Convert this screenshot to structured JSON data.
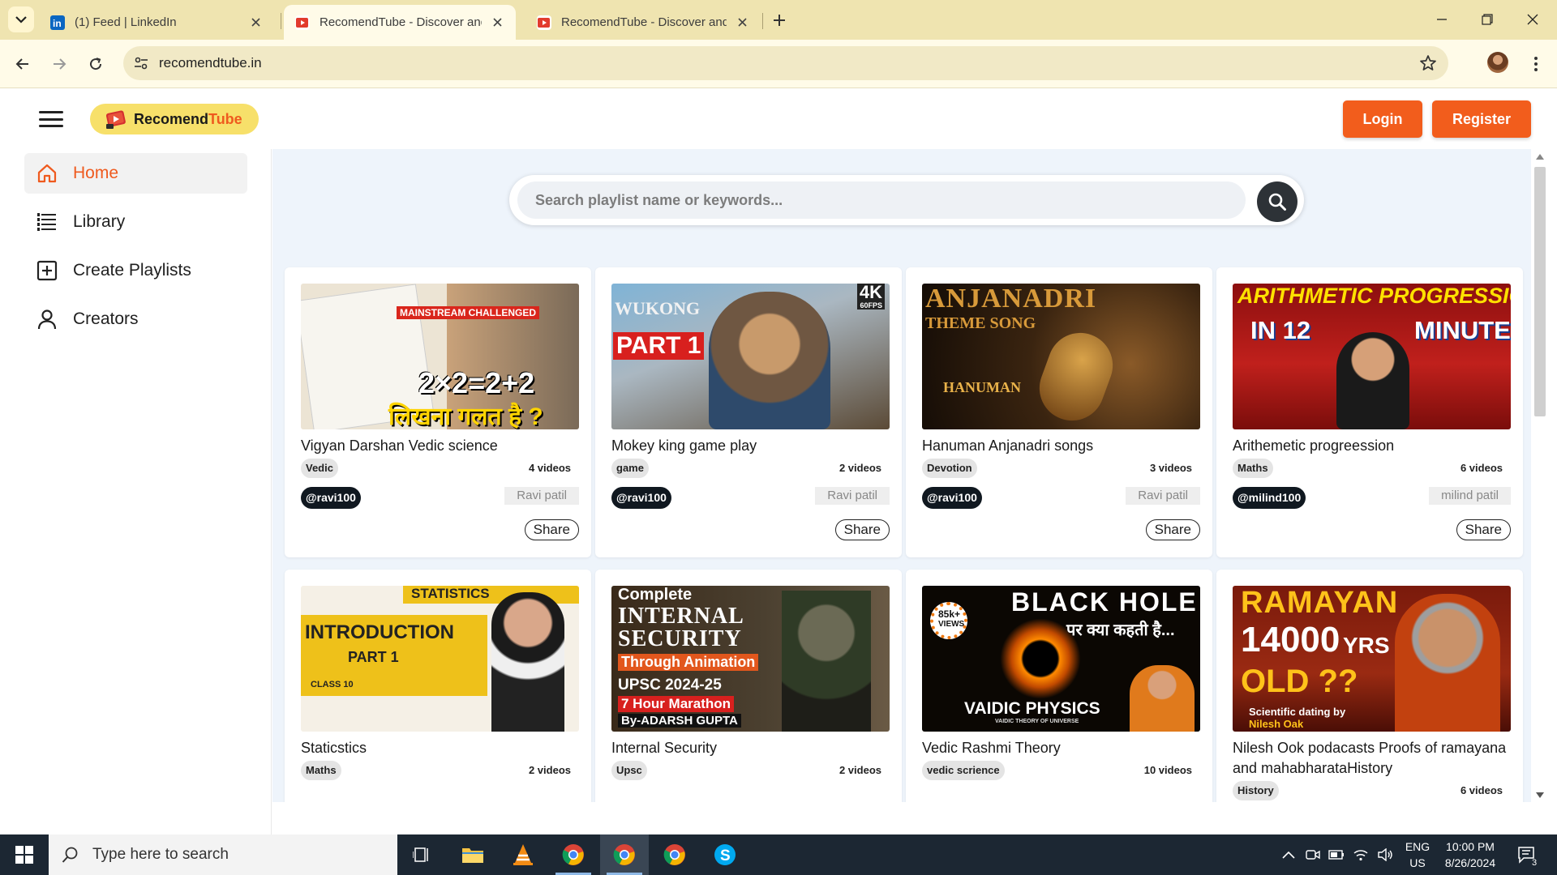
{
  "browser": {
    "tabs": [
      {
        "title": "(1) Feed | LinkedIn",
        "active": false
      },
      {
        "title": "RecomendTube - Discover and",
        "active": true
      },
      {
        "title": "RecomendTube - Discover and",
        "active": false
      }
    ],
    "url": "recomendtube.in"
  },
  "header": {
    "logo_part1": "Recomend",
    "logo_part2": "Tube",
    "login_label": "Login",
    "register_label": "Register"
  },
  "sidebar": {
    "items": [
      {
        "label": "Home",
        "icon": "home-icon",
        "active": true
      },
      {
        "label": "Library",
        "icon": "library-icon",
        "active": false
      },
      {
        "label": "Create Playlists",
        "icon": "add-box-icon",
        "active": false
      },
      {
        "label": "Creators",
        "icon": "person-icon",
        "active": false
      }
    ]
  },
  "search": {
    "placeholder": "Search playlist name or keywords..."
  },
  "playlists": [
    {
      "title": "Vigyan Darshan Vedic science",
      "category": "Vedic",
      "videos": "4 videos",
      "handle": "@ravi100",
      "owner": "Ravi patil",
      "share": "Share",
      "thumb": {
        "t1": "MAINSTREAM CHALLENGED",
        "t2": "2×2=2+2",
        "t3": "लिखना गलत है ?"
      }
    },
    {
      "title": "Mokey king game play",
      "category": "game",
      "videos": "2 videos",
      "handle": "@ravi100",
      "owner": "Ravi patil",
      "share": "Share",
      "thumb": {
        "t1": "WUKONG",
        "t2": "PART 1",
        "t3": "4K",
        "t4": "60FPS"
      }
    },
    {
      "title": "Hanuman Anjanadri songs",
      "category": "Devotion",
      "videos": "3 videos",
      "handle": "@ravi100",
      "owner": "Ravi patil",
      "share": "Share",
      "thumb": {
        "t1": "ANJANADRI",
        "t2": "THEME SONG",
        "t3": "HANUMAN"
      }
    },
    {
      "title": "Arithemetic progreession",
      "category": "Maths",
      "videos": "6 videos",
      "handle": "@milind100",
      "owner": "milind patil",
      "share": "Share",
      "thumb": {
        "t1": "ARITHMETIC PROGRESSIONS",
        "t2": "IN 12",
        "t3": "MINUTES"
      }
    },
    {
      "title": "Staticstics",
      "category": "Maths",
      "videos": "2 videos",
      "thumb": {
        "t1": "STATISTICS",
        "t2": "INTRODUCTION",
        "t3": "PART 1",
        "t4": "CLASS 10"
      }
    },
    {
      "title": "Internal Security",
      "category": "Upsc",
      "videos": "2 videos",
      "thumb": {
        "t1": "Complete",
        "t2": "INTERNAL",
        "t3": "SECURITY",
        "t4": "Through Animation",
        "t5": "UPSC 2024-25",
        "t6": "7 Hour Marathon",
        "t7": "By-ADARSH GUPTA"
      }
    },
    {
      "title": "Vedic Rashmi Theory",
      "category": "vedic scrience",
      "videos": "10 videos",
      "thumb": {
        "t1": "BLACK HOLE",
        "t2": "पर क्या कहती है...",
        "t3": "85k+",
        "t4": "VIEWS",
        "t5": "VAIDIC PHYSICS",
        "t6": "VAIDIC THEORY OF UNIVERSE"
      }
    },
    {
      "title": "Nilesh Ook podacasts Proofs of ramayana and mahabharataHistory",
      "category": "History",
      "videos": "6 videos",
      "thumb": {
        "t1": "RAMAYAN",
        "t2": "14000",
        "t3": "YRS",
        "t4": "OLD ??",
        "t5": "Scientific dating by",
        "t6": "Nilesh Oak"
      }
    }
  ],
  "taskbar": {
    "search_placeholder": "Type here to search",
    "lang1": "ENG",
    "lang2": "US",
    "time": "10:00 PM",
    "date": "8/26/2024",
    "notif_count": "3"
  },
  "colors": {
    "accent": "#f25d1c",
    "logo_bg": "#f7e06a",
    "main_bg": "#eef4fb"
  }
}
